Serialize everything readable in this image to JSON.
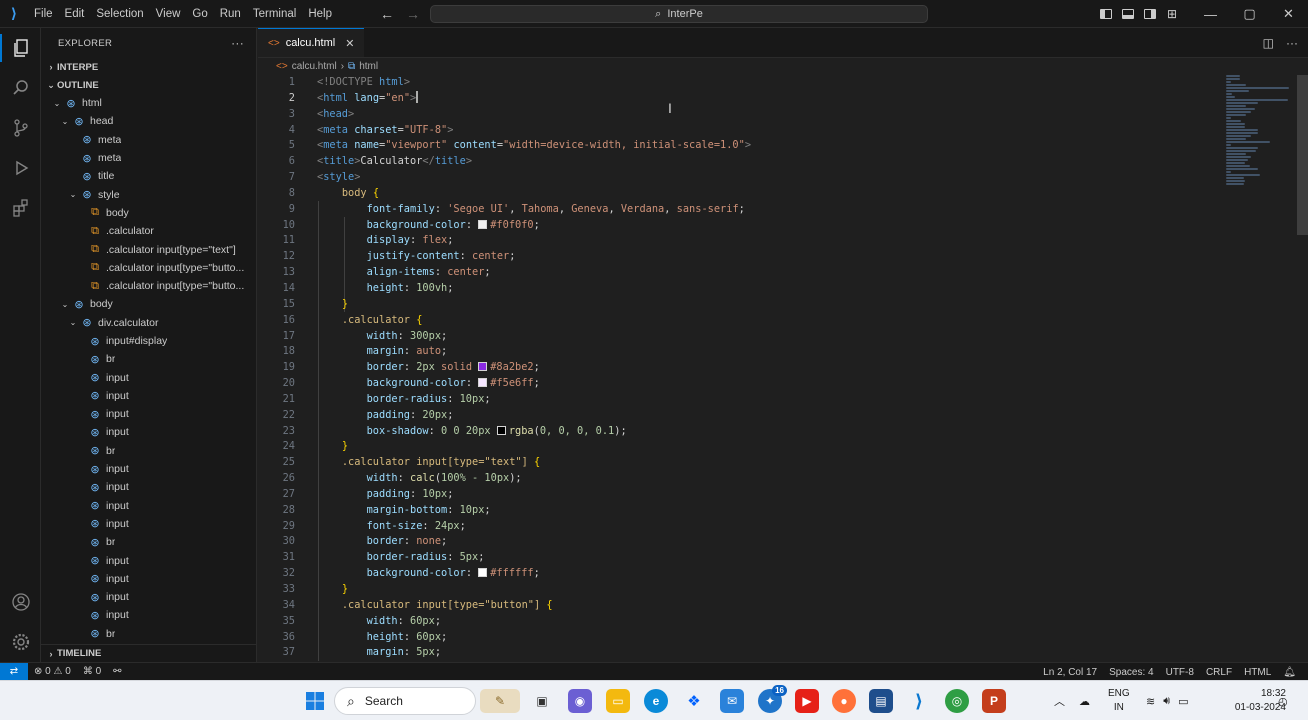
{
  "titlebar": {
    "menu": [
      "File",
      "Edit",
      "Selection",
      "View",
      "Go",
      "Run",
      "Terminal",
      "Help"
    ],
    "search_text": "InterPe",
    "minimize": "—",
    "maximize": "▢",
    "close": "✕"
  },
  "sidebar": {
    "explorer_title": "EXPLORER",
    "more": "···",
    "folder_section": "INTERPE",
    "outline_section": "OUTLINE",
    "timeline_section": "TIMELINE",
    "outline": [
      {
        "label": "html",
        "depth": 0,
        "twist": "⌄",
        "icon": "tag"
      },
      {
        "label": "head",
        "depth": 1,
        "twist": "⌄",
        "icon": "tag"
      },
      {
        "label": "meta",
        "depth": 2,
        "twist": "",
        "icon": "tag"
      },
      {
        "label": "meta",
        "depth": 2,
        "twist": "",
        "icon": "tag"
      },
      {
        "label": "title",
        "depth": 2,
        "twist": "",
        "icon": "tag"
      },
      {
        "label": "style",
        "depth": 2,
        "twist": "⌄",
        "icon": "tag"
      },
      {
        "label": "body",
        "depth": 3,
        "twist": "",
        "icon": "css"
      },
      {
        "label": ".calculator",
        "depth": 3,
        "twist": "",
        "icon": "css"
      },
      {
        "label": ".calculator input[type=\"text\"]",
        "depth": 3,
        "twist": "",
        "icon": "css"
      },
      {
        "label": ".calculator input[type=\"butto...",
        "depth": 3,
        "twist": "",
        "icon": "css"
      },
      {
        "label": ".calculator input[type=\"butto...",
        "depth": 3,
        "twist": "",
        "icon": "css"
      },
      {
        "label": "body",
        "depth": 1,
        "twist": "⌄",
        "icon": "tag"
      },
      {
        "label": "div.calculator",
        "depth": 2,
        "twist": "⌄",
        "icon": "tag"
      },
      {
        "label": "input#display",
        "depth": 3,
        "twist": "",
        "icon": "tag"
      },
      {
        "label": "br",
        "depth": 3,
        "twist": "",
        "icon": "tag"
      },
      {
        "label": "input",
        "depth": 3,
        "twist": "",
        "icon": "tag"
      },
      {
        "label": "input",
        "depth": 3,
        "twist": "",
        "icon": "tag"
      },
      {
        "label": "input",
        "depth": 3,
        "twist": "",
        "icon": "tag"
      },
      {
        "label": "input",
        "depth": 3,
        "twist": "",
        "icon": "tag"
      },
      {
        "label": "br",
        "depth": 3,
        "twist": "",
        "icon": "tag"
      },
      {
        "label": "input",
        "depth": 3,
        "twist": "",
        "icon": "tag"
      },
      {
        "label": "input",
        "depth": 3,
        "twist": "",
        "icon": "tag"
      },
      {
        "label": "input",
        "depth": 3,
        "twist": "",
        "icon": "tag"
      },
      {
        "label": "input",
        "depth": 3,
        "twist": "",
        "icon": "tag"
      },
      {
        "label": "br",
        "depth": 3,
        "twist": "",
        "icon": "tag"
      },
      {
        "label": "input",
        "depth": 3,
        "twist": "",
        "icon": "tag"
      },
      {
        "label": "input",
        "depth": 3,
        "twist": "",
        "icon": "tag"
      },
      {
        "label": "input",
        "depth": 3,
        "twist": "",
        "icon": "tag"
      },
      {
        "label": "input",
        "depth": 3,
        "twist": "",
        "icon": "tag"
      },
      {
        "label": "br",
        "depth": 3,
        "twist": "",
        "icon": "tag"
      }
    ]
  },
  "editor": {
    "tab_label": "calcu.html",
    "breadcrumb_file": "calcu.html",
    "breadcrumb_symbol": "html",
    "current_line": 2,
    "lines": [
      [
        [
          "t-tag",
          "<!DOCTYPE "
        ],
        [
          "t-tn",
          "html"
        ],
        [
          "t-tag",
          ">"
        ]
      ],
      [
        [
          "t-tag",
          "<"
        ],
        [
          "t-tn",
          "html"
        ],
        [
          "t-p",
          " "
        ],
        [
          "t-an",
          "lang"
        ],
        [
          "t-p",
          "="
        ],
        [
          "t-av",
          "\"en\""
        ],
        [
          "t-tag",
          ">"
        ]
      ],
      [
        [
          "t-tag",
          "<"
        ],
        [
          "t-tn",
          "head"
        ],
        [
          "t-tag",
          ">"
        ]
      ],
      [
        [
          "t-tag",
          "<"
        ],
        [
          "t-tn",
          "meta"
        ],
        [
          "t-p",
          " "
        ],
        [
          "t-an",
          "charset"
        ],
        [
          "t-p",
          "="
        ],
        [
          "t-av",
          "\"UTF-8\""
        ],
        [
          "t-tag",
          ">"
        ]
      ],
      [
        [
          "t-tag",
          "<"
        ],
        [
          "t-tn",
          "meta"
        ],
        [
          "t-p",
          " "
        ],
        [
          "t-an",
          "name"
        ],
        [
          "t-p",
          "="
        ],
        [
          "t-av",
          "\"viewport\""
        ],
        [
          "t-p",
          " "
        ],
        [
          "t-an",
          "content"
        ],
        [
          "t-p",
          "="
        ],
        [
          "t-av",
          "\"width=device-width, initial-scale=1.0\""
        ],
        [
          "t-tag",
          ">"
        ]
      ],
      [
        [
          "t-tag",
          "<"
        ],
        [
          "t-tn",
          "title"
        ],
        [
          "t-tag",
          ">"
        ],
        [
          "t-p",
          "Calculator"
        ],
        [
          "t-tag",
          "</"
        ],
        [
          "t-tn",
          "title"
        ],
        [
          "t-tag",
          ">"
        ]
      ],
      [
        [
          "t-tag",
          "<"
        ],
        [
          "t-tn",
          "style"
        ],
        [
          "t-tag",
          ">"
        ]
      ],
      [
        [
          "t-p",
          "    "
        ],
        [
          "t-sel",
          "body"
        ],
        [
          "t-p",
          " "
        ],
        [
          "t-br",
          "{"
        ]
      ],
      [
        [
          "t-p",
          "        "
        ],
        [
          "t-prop",
          "font-family"
        ],
        [
          "t-p",
          ": "
        ],
        [
          "t-val",
          "'Segoe UI'"
        ],
        [
          "t-p",
          ", "
        ],
        [
          "t-val",
          "Tahoma"
        ],
        [
          "t-p",
          ", "
        ],
        [
          "t-val",
          "Geneva"
        ],
        [
          "t-p",
          ", "
        ],
        [
          "t-val",
          "Verdana"
        ],
        [
          "t-p",
          ", "
        ],
        [
          "t-val",
          "sans-serif"
        ],
        [
          "t-p",
          ";"
        ]
      ],
      [
        [
          "t-p",
          "        "
        ],
        [
          "t-prop",
          "background-color"
        ],
        [
          "t-p",
          ": "
        ],
        [
          "swatch:#f0f0f0",
          ""
        ],
        [
          "t-val",
          "#f0f0f0"
        ],
        [
          "t-p",
          ";"
        ]
      ],
      [
        [
          "t-p",
          "        "
        ],
        [
          "t-prop",
          "display"
        ],
        [
          "t-p",
          ": "
        ],
        [
          "t-val",
          "flex"
        ],
        [
          "t-p",
          ";"
        ]
      ],
      [
        [
          "t-p",
          "        "
        ],
        [
          "t-prop",
          "justify-content"
        ],
        [
          "t-p",
          ": "
        ],
        [
          "t-val",
          "center"
        ],
        [
          "t-p",
          ";"
        ]
      ],
      [
        [
          "t-p",
          "        "
        ],
        [
          "t-prop",
          "align-items"
        ],
        [
          "t-p",
          ": "
        ],
        [
          "t-val",
          "center"
        ],
        [
          "t-p",
          ";"
        ]
      ],
      [
        [
          "t-p",
          "        "
        ],
        [
          "t-prop",
          "height"
        ],
        [
          "t-p",
          ": "
        ],
        [
          "t-num",
          "100vh"
        ],
        [
          "t-p",
          ";"
        ]
      ],
      [
        [
          "t-p",
          "    "
        ],
        [
          "t-br",
          "}"
        ]
      ],
      [
        [
          "t-p",
          "    "
        ],
        [
          "t-sel",
          ".calculator"
        ],
        [
          "t-p",
          " "
        ],
        [
          "t-br",
          "{"
        ]
      ],
      [
        [
          "t-p",
          "        "
        ],
        [
          "t-prop",
          "width"
        ],
        [
          "t-p",
          ": "
        ],
        [
          "t-num",
          "300px"
        ],
        [
          "t-p",
          ";"
        ]
      ],
      [
        [
          "t-p",
          "        "
        ],
        [
          "t-prop",
          "margin"
        ],
        [
          "t-p",
          ": "
        ],
        [
          "t-val",
          "auto"
        ],
        [
          "t-p",
          ";"
        ]
      ],
      [
        [
          "t-p",
          "        "
        ],
        [
          "t-prop",
          "border"
        ],
        [
          "t-p",
          ": "
        ],
        [
          "t-num",
          "2px"
        ],
        [
          "t-p",
          " "
        ],
        [
          "t-val",
          "solid"
        ],
        [
          "t-p",
          " "
        ],
        [
          "swatch:#8a2be2",
          ""
        ],
        [
          "t-val",
          "#8a2be2"
        ],
        [
          "t-p",
          ";"
        ]
      ],
      [
        [
          "t-p",
          "        "
        ],
        [
          "t-prop",
          "background-color"
        ],
        [
          "t-p",
          ": "
        ],
        [
          "swatch:#f5e6ff",
          ""
        ],
        [
          "t-val",
          "#f5e6ff"
        ],
        [
          "t-p",
          ";"
        ]
      ],
      [
        [
          "t-p",
          "        "
        ],
        [
          "t-prop",
          "border-radius"
        ],
        [
          "t-p",
          ": "
        ],
        [
          "t-num",
          "10px"
        ],
        [
          "t-p",
          ";"
        ]
      ],
      [
        [
          "t-p",
          "        "
        ],
        [
          "t-prop",
          "padding"
        ],
        [
          "t-p",
          ": "
        ],
        [
          "t-num",
          "20px"
        ],
        [
          "t-p",
          ";"
        ]
      ],
      [
        [
          "t-p",
          "        "
        ],
        [
          "t-prop",
          "box-shadow"
        ],
        [
          "t-p",
          ": "
        ],
        [
          "t-num",
          "0 0 20px"
        ],
        [
          "t-p",
          " "
        ],
        [
          "swatch:#000000",
          ""
        ],
        [
          "t-fn",
          "rgba"
        ],
        [
          "t-p",
          "("
        ],
        [
          "t-num",
          "0, 0, 0, 0.1"
        ],
        [
          "t-p",
          ");"
        ]
      ],
      [
        [
          "t-p",
          "    "
        ],
        [
          "t-br",
          "}"
        ]
      ],
      [
        [
          "t-p",
          "    "
        ],
        [
          "t-sel",
          ".calculator input[type=\"text\"]"
        ],
        [
          "t-p",
          " "
        ],
        [
          "t-br",
          "{"
        ]
      ],
      [
        [
          "t-p",
          "        "
        ],
        [
          "t-prop",
          "width"
        ],
        [
          "t-p",
          ": "
        ],
        [
          "t-fn",
          "calc"
        ],
        [
          "t-p",
          "("
        ],
        [
          "t-num",
          "100% - 10px"
        ],
        [
          "t-p",
          ");"
        ]
      ],
      [
        [
          "t-p",
          "        "
        ],
        [
          "t-prop",
          "padding"
        ],
        [
          "t-p",
          ": "
        ],
        [
          "t-num",
          "10px"
        ],
        [
          "t-p",
          ";"
        ]
      ],
      [
        [
          "t-p",
          "        "
        ],
        [
          "t-prop",
          "margin-bottom"
        ],
        [
          "t-p",
          ": "
        ],
        [
          "t-num",
          "10px"
        ],
        [
          "t-p",
          ";"
        ]
      ],
      [
        [
          "t-p",
          "        "
        ],
        [
          "t-prop",
          "font-size"
        ],
        [
          "t-p",
          ": "
        ],
        [
          "t-num",
          "24px"
        ],
        [
          "t-p",
          ";"
        ]
      ],
      [
        [
          "t-p",
          "        "
        ],
        [
          "t-prop",
          "border"
        ],
        [
          "t-p",
          ": "
        ],
        [
          "t-val",
          "none"
        ],
        [
          "t-p",
          ";"
        ]
      ],
      [
        [
          "t-p",
          "        "
        ],
        [
          "t-prop",
          "border-radius"
        ],
        [
          "t-p",
          ": "
        ],
        [
          "t-num",
          "5px"
        ],
        [
          "t-p",
          ";"
        ]
      ],
      [
        [
          "t-p",
          "        "
        ],
        [
          "t-prop",
          "background-color"
        ],
        [
          "t-p",
          ": "
        ],
        [
          "swatch:#ffffff",
          ""
        ],
        [
          "t-val",
          "#ffffff"
        ],
        [
          "t-p",
          ";"
        ]
      ],
      [
        [
          "t-p",
          "    "
        ],
        [
          "t-br",
          "}"
        ]
      ],
      [
        [
          "t-p",
          "    "
        ],
        [
          "t-sel",
          ".calculator input[type=\"button\"]"
        ],
        [
          "t-p",
          " "
        ],
        [
          "t-br",
          "{"
        ]
      ],
      [
        [
          "t-p",
          "        "
        ],
        [
          "t-prop",
          "width"
        ],
        [
          "t-p",
          ": "
        ],
        [
          "t-num",
          "60px"
        ],
        [
          "t-p",
          ";"
        ]
      ],
      [
        [
          "t-p",
          "        "
        ],
        [
          "t-prop",
          "height"
        ],
        [
          "t-p",
          ": "
        ],
        [
          "t-num",
          "60px"
        ],
        [
          "t-p",
          ";"
        ]
      ],
      [
        [
          "t-p",
          "        "
        ],
        [
          "t-prop",
          "margin"
        ],
        [
          "t-p",
          ": "
        ],
        [
          "t-num",
          "5px"
        ],
        [
          "t-p",
          ";"
        ]
      ]
    ]
  },
  "statusbar": {
    "errors": "0",
    "warnings": "0",
    "ports": "0",
    "position": "Ln 2, Col 17",
    "spaces": "Spaces: 4",
    "encoding": "UTF-8",
    "eol": "CRLF",
    "language": "HTML"
  },
  "taskbar": {
    "search_label": "Search",
    "lang_line1": "ENG",
    "lang_line2": "IN",
    "time": "18:32",
    "date": "01-03-2024",
    "badge_count": "16"
  },
  "colors": {
    "accent": "#0078d4",
    "editor_bg": "#1f1f1f",
    "chrome_bg": "#181818",
    "taskbar_bg": "#eef1f6"
  }
}
